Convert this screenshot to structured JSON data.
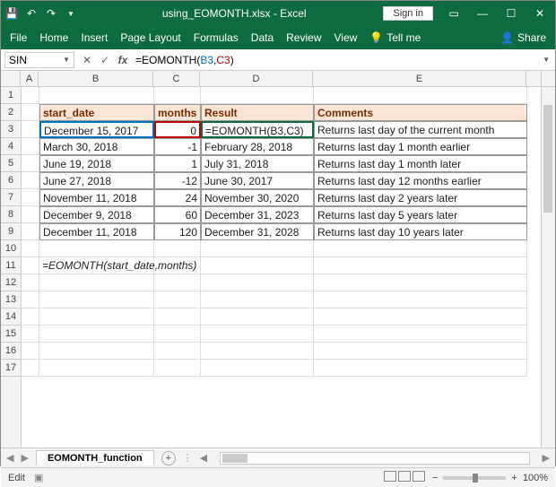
{
  "title": "using_EOMONTH.xlsx - Excel",
  "signin": "Sign in",
  "ribbon": {
    "file": "File",
    "home": "Home",
    "insert": "Insert",
    "page_layout": "Page Layout",
    "formulas": "Formulas",
    "data": "Data",
    "review": "Review",
    "view": "View",
    "tell_me": "Tell me",
    "share": "Share"
  },
  "name_box": "SIN",
  "formula_prefix": "=EOMONTH(",
  "formula_ref_b": "B3",
  "formula_comma": ",",
  "formula_ref_c": "C3",
  "formula_suffix": ")",
  "columns": [
    "A",
    "B",
    "C",
    "D",
    "E"
  ],
  "rows": [
    "1",
    "2",
    "3",
    "4",
    "5",
    "6",
    "7",
    "8",
    "9",
    "10",
    "11",
    "12",
    "13",
    "14",
    "15",
    "16",
    "17"
  ],
  "headers": {
    "b": "start_date",
    "c": "months",
    "d": "Result",
    "e": "Comments"
  },
  "data_rows": [
    {
      "b": "December 15, 2017",
      "c": "0",
      "d": "=EOMONTH(B3,C3)",
      "e": "Returns last day of the current month"
    },
    {
      "b": "March 30, 2018",
      "c": "-1",
      "d": "February 28, 2018",
      "e": "Returns last day 1 month earlier"
    },
    {
      "b": "June 19, 2018",
      "c": "1",
      "d": "July 31, 2018",
      "e": "Returns last day 1 month later"
    },
    {
      "b": "June 27, 2018",
      "c": "-12",
      "d": "June 30, 2017",
      "e": "Returns last day 12 months earlier"
    },
    {
      "b": "November 11, 2018",
      "c": "24",
      "d": "November 30, 2020",
      "e": "Returns last day 2 years later"
    },
    {
      "b": "December 9, 2018",
      "c": "60",
      "d": "December 31, 2023",
      "e": "Returns last day 5 years later"
    },
    {
      "b": "December 11, 2018",
      "c": "120",
      "d": "December 31, 2028",
      "e": "Returns last day 10 years later"
    }
  ],
  "syntax_line": "=EOMONTH(start_date,months)",
  "sheet_name": "EOMONTH_function",
  "status_mode": "Edit",
  "zoom": "100%"
}
